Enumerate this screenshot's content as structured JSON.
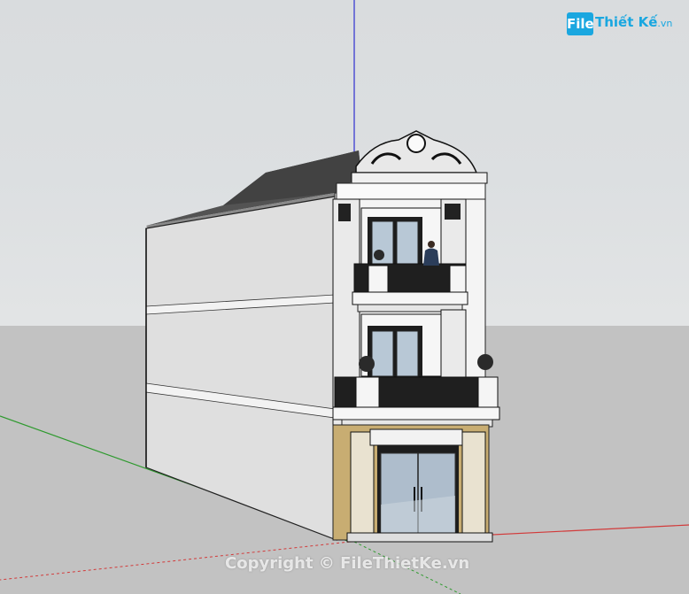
{
  "logo": {
    "badge": "File",
    "name": "Thiết Kế",
    "suffix": ".vn"
  },
  "watermark": {
    "text": "Copyright © FileThietKe.vn"
  },
  "colors": {
    "sky": "#dcdfe1",
    "ground": "#c2c2c2",
    "axis_red": "#d23a3a",
    "axis_green": "#2f9a2f",
    "axis_blue": "#2f2fd0",
    "wall_side": "#dfdfdf",
    "roof": "#3b3b3b",
    "stone_base": "#c8ad72",
    "glass": "#b8c8d6",
    "brand": "#1aa7e0"
  },
  "icons": [
    "model-axes-icon",
    "person-figure-icon",
    "planter-urn-icon"
  ]
}
